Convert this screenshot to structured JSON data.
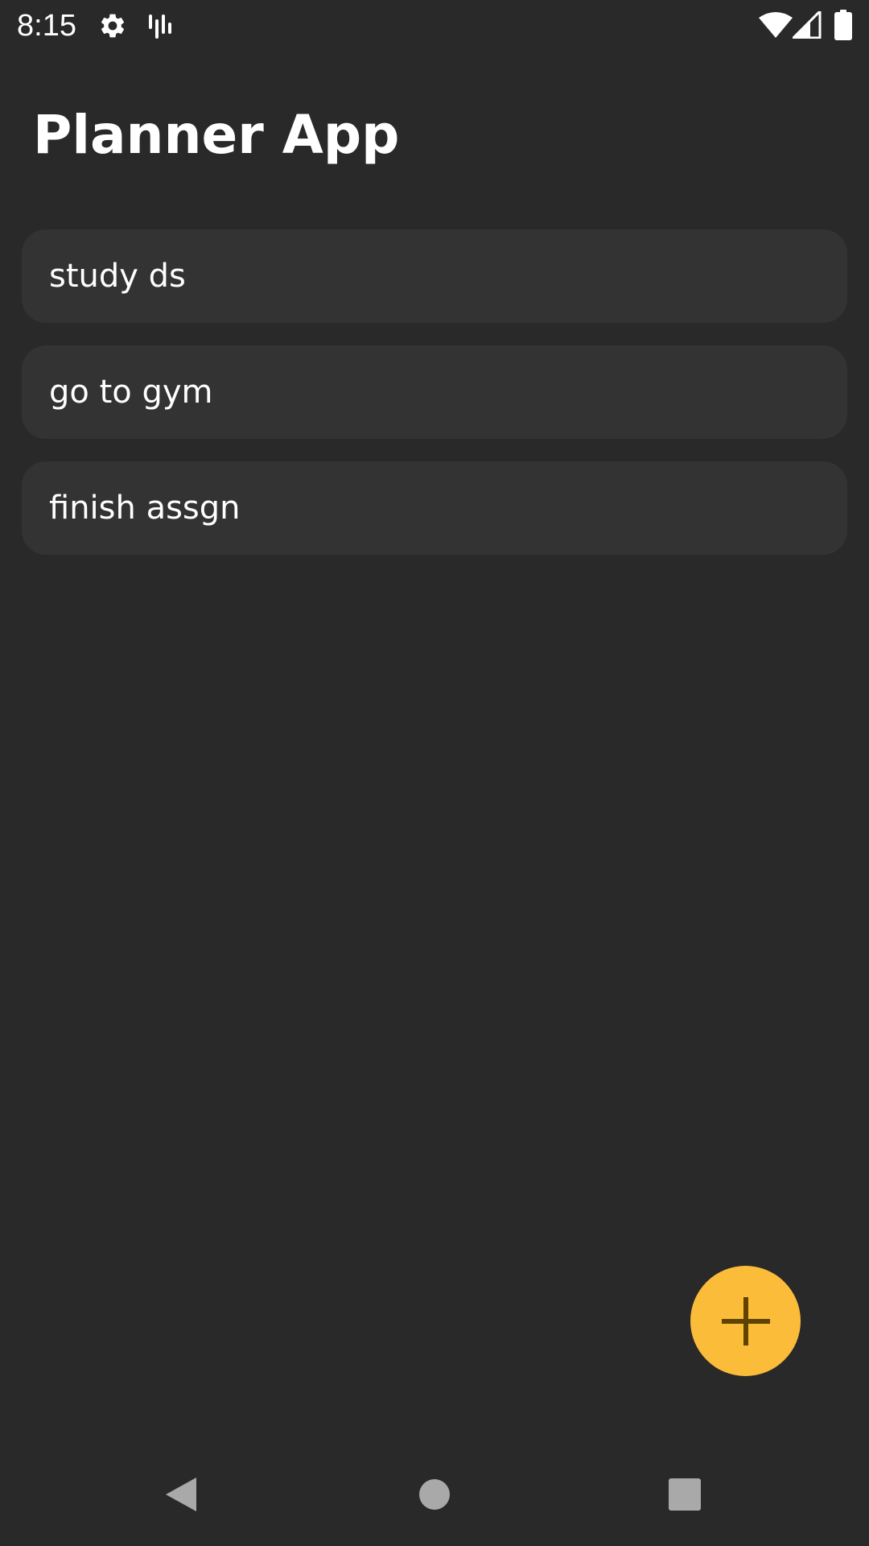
{
  "status_bar": {
    "time": "8:15",
    "icons": [
      "settings-gear-icon",
      "notification-signal-bars-icon",
      "wifi-icon",
      "cell-signal-icon",
      "battery-icon"
    ]
  },
  "app": {
    "title": "Planner App"
  },
  "tasks": [
    {
      "label": "study ds"
    },
    {
      "label": "go to gym"
    },
    {
      "label": "finish assgn"
    }
  ],
  "fab": {
    "icon": "plus-icon",
    "color": "#fbbc3a",
    "icon_color": "#5e4300"
  },
  "nav_bar": {
    "buttons": [
      "back-icon",
      "home-icon",
      "recents-icon"
    ]
  },
  "colors": {
    "background": "#292929",
    "card": "#333333",
    "text": "#ffffff"
  }
}
